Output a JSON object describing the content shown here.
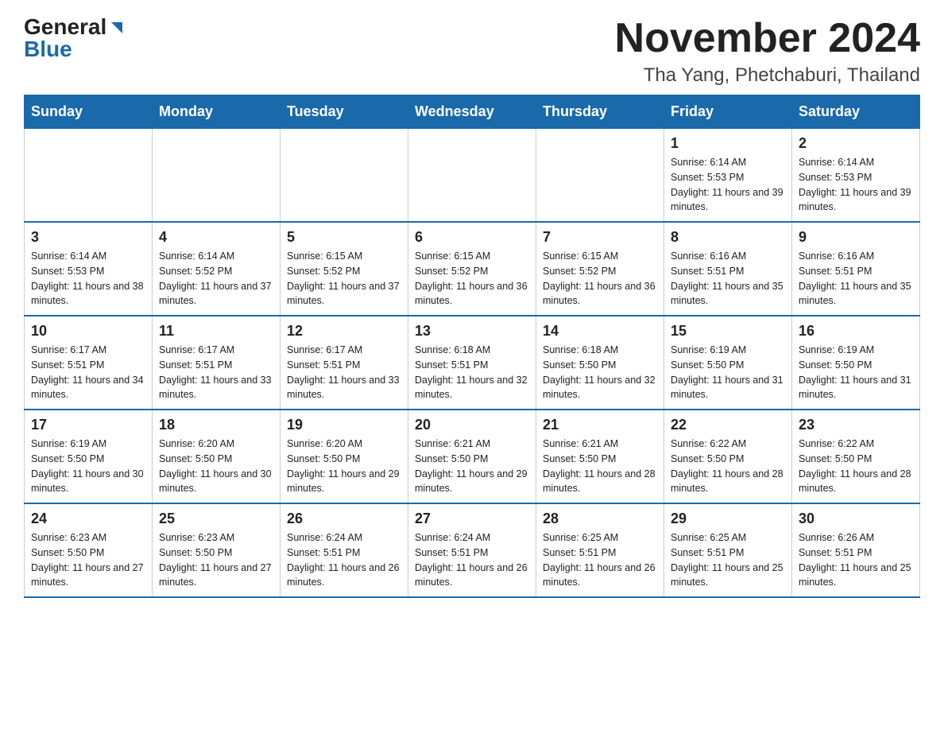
{
  "header": {
    "logo_general": "General",
    "logo_blue": "Blue",
    "month_title": "November 2024",
    "location": "Tha Yang, Phetchaburi, Thailand"
  },
  "weekdays": [
    "Sunday",
    "Monday",
    "Tuesday",
    "Wednesday",
    "Thursday",
    "Friday",
    "Saturday"
  ],
  "weeks": [
    [
      {
        "day": "",
        "sunrise": "",
        "sunset": "",
        "daylight": ""
      },
      {
        "day": "",
        "sunrise": "",
        "sunset": "",
        "daylight": ""
      },
      {
        "day": "",
        "sunrise": "",
        "sunset": "",
        "daylight": ""
      },
      {
        "day": "",
        "sunrise": "",
        "sunset": "",
        "daylight": ""
      },
      {
        "day": "",
        "sunrise": "",
        "sunset": "",
        "daylight": ""
      },
      {
        "day": "1",
        "sunrise": "Sunrise: 6:14 AM",
        "sunset": "Sunset: 5:53 PM",
        "daylight": "Daylight: 11 hours and 39 minutes."
      },
      {
        "day": "2",
        "sunrise": "Sunrise: 6:14 AM",
        "sunset": "Sunset: 5:53 PM",
        "daylight": "Daylight: 11 hours and 39 minutes."
      }
    ],
    [
      {
        "day": "3",
        "sunrise": "Sunrise: 6:14 AM",
        "sunset": "Sunset: 5:53 PM",
        "daylight": "Daylight: 11 hours and 38 minutes."
      },
      {
        "day": "4",
        "sunrise": "Sunrise: 6:14 AM",
        "sunset": "Sunset: 5:52 PM",
        "daylight": "Daylight: 11 hours and 37 minutes."
      },
      {
        "day": "5",
        "sunrise": "Sunrise: 6:15 AM",
        "sunset": "Sunset: 5:52 PM",
        "daylight": "Daylight: 11 hours and 37 minutes."
      },
      {
        "day": "6",
        "sunrise": "Sunrise: 6:15 AM",
        "sunset": "Sunset: 5:52 PM",
        "daylight": "Daylight: 11 hours and 36 minutes."
      },
      {
        "day": "7",
        "sunrise": "Sunrise: 6:15 AM",
        "sunset": "Sunset: 5:52 PM",
        "daylight": "Daylight: 11 hours and 36 minutes."
      },
      {
        "day": "8",
        "sunrise": "Sunrise: 6:16 AM",
        "sunset": "Sunset: 5:51 PM",
        "daylight": "Daylight: 11 hours and 35 minutes."
      },
      {
        "day": "9",
        "sunrise": "Sunrise: 6:16 AM",
        "sunset": "Sunset: 5:51 PM",
        "daylight": "Daylight: 11 hours and 35 minutes."
      }
    ],
    [
      {
        "day": "10",
        "sunrise": "Sunrise: 6:17 AM",
        "sunset": "Sunset: 5:51 PM",
        "daylight": "Daylight: 11 hours and 34 minutes."
      },
      {
        "day": "11",
        "sunrise": "Sunrise: 6:17 AM",
        "sunset": "Sunset: 5:51 PM",
        "daylight": "Daylight: 11 hours and 33 minutes."
      },
      {
        "day": "12",
        "sunrise": "Sunrise: 6:17 AM",
        "sunset": "Sunset: 5:51 PM",
        "daylight": "Daylight: 11 hours and 33 minutes."
      },
      {
        "day": "13",
        "sunrise": "Sunrise: 6:18 AM",
        "sunset": "Sunset: 5:51 PM",
        "daylight": "Daylight: 11 hours and 32 minutes."
      },
      {
        "day": "14",
        "sunrise": "Sunrise: 6:18 AM",
        "sunset": "Sunset: 5:50 PM",
        "daylight": "Daylight: 11 hours and 32 minutes."
      },
      {
        "day": "15",
        "sunrise": "Sunrise: 6:19 AM",
        "sunset": "Sunset: 5:50 PM",
        "daylight": "Daylight: 11 hours and 31 minutes."
      },
      {
        "day": "16",
        "sunrise": "Sunrise: 6:19 AM",
        "sunset": "Sunset: 5:50 PM",
        "daylight": "Daylight: 11 hours and 31 minutes."
      }
    ],
    [
      {
        "day": "17",
        "sunrise": "Sunrise: 6:19 AM",
        "sunset": "Sunset: 5:50 PM",
        "daylight": "Daylight: 11 hours and 30 minutes."
      },
      {
        "day": "18",
        "sunrise": "Sunrise: 6:20 AM",
        "sunset": "Sunset: 5:50 PM",
        "daylight": "Daylight: 11 hours and 30 minutes."
      },
      {
        "day": "19",
        "sunrise": "Sunrise: 6:20 AM",
        "sunset": "Sunset: 5:50 PM",
        "daylight": "Daylight: 11 hours and 29 minutes."
      },
      {
        "day": "20",
        "sunrise": "Sunrise: 6:21 AM",
        "sunset": "Sunset: 5:50 PM",
        "daylight": "Daylight: 11 hours and 29 minutes."
      },
      {
        "day": "21",
        "sunrise": "Sunrise: 6:21 AM",
        "sunset": "Sunset: 5:50 PM",
        "daylight": "Daylight: 11 hours and 28 minutes."
      },
      {
        "day": "22",
        "sunrise": "Sunrise: 6:22 AM",
        "sunset": "Sunset: 5:50 PM",
        "daylight": "Daylight: 11 hours and 28 minutes."
      },
      {
        "day": "23",
        "sunrise": "Sunrise: 6:22 AM",
        "sunset": "Sunset: 5:50 PM",
        "daylight": "Daylight: 11 hours and 28 minutes."
      }
    ],
    [
      {
        "day": "24",
        "sunrise": "Sunrise: 6:23 AM",
        "sunset": "Sunset: 5:50 PM",
        "daylight": "Daylight: 11 hours and 27 minutes."
      },
      {
        "day": "25",
        "sunrise": "Sunrise: 6:23 AM",
        "sunset": "Sunset: 5:50 PM",
        "daylight": "Daylight: 11 hours and 27 minutes."
      },
      {
        "day": "26",
        "sunrise": "Sunrise: 6:24 AM",
        "sunset": "Sunset: 5:51 PM",
        "daylight": "Daylight: 11 hours and 26 minutes."
      },
      {
        "day": "27",
        "sunrise": "Sunrise: 6:24 AM",
        "sunset": "Sunset: 5:51 PM",
        "daylight": "Daylight: 11 hours and 26 minutes."
      },
      {
        "day": "28",
        "sunrise": "Sunrise: 6:25 AM",
        "sunset": "Sunset: 5:51 PM",
        "daylight": "Daylight: 11 hours and 26 minutes."
      },
      {
        "day": "29",
        "sunrise": "Sunrise: 6:25 AM",
        "sunset": "Sunset: 5:51 PM",
        "daylight": "Daylight: 11 hours and 25 minutes."
      },
      {
        "day": "30",
        "sunrise": "Sunrise: 6:26 AM",
        "sunset": "Sunset: 5:51 PM",
        "daylight": "Daylight: 11 hours and 25 minutes."
      }
    ]
  ]
}
